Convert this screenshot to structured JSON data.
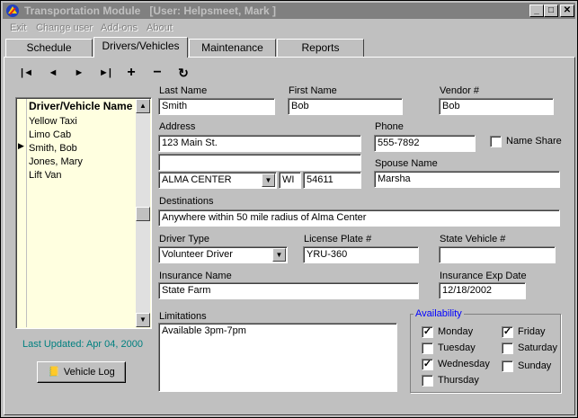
{
  "window": {
    "title": "Transportation Module   [User: Helpsmeet, Mark ]",
    "buttons": {
      "minimize": "_",
      "maximize": "□",
      "close": "✕"
    }
  },
  "menu": [
    "Exit",
    "Change user",
    "Add-ons",
    "About"
  ],
  "tabs": [
    "Schedule",
    "Drivers/Vehicles",
    "Maintenance",
    "Reports"
  ],
  "nav": {
    "first": "|◄",
    "prev": "◄",
    "next": "►",
    "last": "►|",
    "add": "+",
    "delete": "−",
    "refresh": "↻"
  },
  "list": {
    "header": "Driver/Vehicle Name",
    "items": [
      "Yellow Taxi",
      "Limo Cab",
      "Smith, Bob",
      "Jones, Mary",
      "Lift Van"
    ],
    "selected_marker": "▶"
  },
  "last_updated": "Last Updated:  Apr 04, 2000",
  "vehicle_log_button": "Vehicle Log",
  "form": {
    "last_name": {
      "label": "Last Name",
      "value": "Smith"
    },
    "first_name": {
      "label": "First Name",
      "value": "Bob"
    },
    "vendor": {
      "label": "Vendor #",
      "value": "Bob"
    },
    "address": {
      "label": "Address",
      "line1": "123 Main St.",
      "line2": ""
    },
    "city": "ALMA CENTER",
    "state": "WI",
    "zip": "54611",
    "phone": {
      "label": "Phone",
      "value": "555-7892"
    },
    "name_share": {
      "label": "Name Share",
      "checked": false
    },
    "spouse": {
      "label": "Spouse Name",
      "value": "Marsha"
    },
    "destinations": {
      "label": "Destinations",
      "value": "Anywhere within 50 mile radius of Alma Center"
    },
    "driver_type": {
      "label": "Driver Type",
      "value": "Volunteer Driver"
    },
    "license_plate": {
      "label": "License Plate #",
      "value": "YRU-360"
    },
    "state_vehicle": {
      "label": "State Vehicle #",
      "value": ""
    },
    "insurance_name": {
      "label": "Insurance Name",
      "value": "State Farm"
    },
    "insurance_exp": {
      "label": "Insurance Exp Date",
      "value": "12/18/2002"
    },
    "limitations": {
      "label": "Limitations",
      "value": "Available 3pm-7pm"
    }
  },
  "availability": {
    "title": "Availability",
    "days": {
      "monday": {
        "label": "Monday",
        "checked": "✓"
      },
      "tuesday": {
        "label": "Tuesday",
        "checked": ""
      },
      "wednesday": {
        "label": "Wednesday",
        "checked": "✓"
      },
      "thursday": {
        "label": "Thursday",
        "checked": ""
      },
      "friday": {
        "label": "Friday",
        "checked": "✓"
      },
      "saturday": {
        "label": "Saturday",
        "checked": ""
      },
      "sunday": {
        "label": "Sunday",
        "checked": ""
      }
    }
  },
  "colors": {
    "titlebar": "#808080",
    "face": "#c0c0c0",
    "list_bg": "#ffffe0",
    "status_text": "#008080",
    "group_title": "#0000ff"
  }
}
